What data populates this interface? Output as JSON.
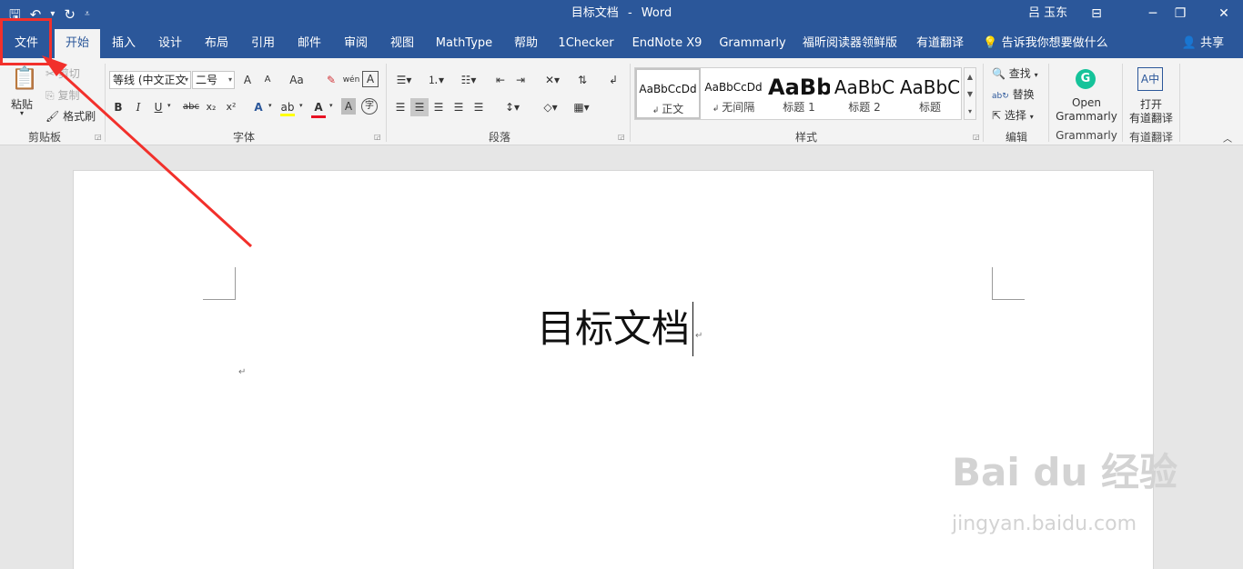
{
  "window": {
    "doc_name": "目标文档",
    "app_name": "Word",
    "title_sep": "-",
    "user": "吕 玉东"
  },
  "tabs": [
    "文件",
    "开始",
    "插入",
    "设计",
    "布局",
    "引用",
    "邮件",
    "审阅",
    "视图",
    "MathType",
    "帮助",
    "1Checker",
    "EndNote X9",
    "Grammarly",
    "福昕阅读器领鲜版",
    "有道翻译"
  ],
  "tell_me": "告诉我你想要做什么",
  "share": "共享",
  "clipboard": {
    "paste": "粘贴",
    "cut": "剪切",
    "copy": "复制",
    "format_painter": "格式刷",
    "label": "剪贴板"
  },
  "font": {
    "name": "等线 (中文正文",
    "size": "二号",
    "grow": "A",
    "shrink": "A",
    "case": "Aa",
    "pinyin": "wén",
    "bold": "B",
    "italic": "I",
    "underline": "U",
    "strike": "abc",
    "subscript": "x₂",
    "superscript": "x²",
    "font_color": "A",
    "label": "字体",
    "font_color_value": "#e81123",
    "highlight_value": "#ffff00"
  },
  "paragraph": {
    "label": "段落"
  },
  "styles": {
    "label": "样式",
    "items": [
      {
        "sample": "AaBbCcDd",
        "name": "正文"
      },
      {
        "sample": "AaBbCcDd",
        "name": "无间隔"
      },
      {
        "sample": "AaBb",
        "name": "标题 1"
      },
      {
        "sample": "AaBbC",
        "name": "标题 2"
      },
      {
        "sample": "AaBbC",
        "name": "标题"
      }
    ]
  },
  "editing": {
    "find": "查找",
    "replace": "替换",
    "select": "选择",
    "label": "编辑"
  },
  "grammarly": {
    "open": "Open",
    "name": "Grammarly",
    "label": "Grammarly"
  },
  "youdao": {
    "open": "打开",
    "name": "有道翻译",
    "label": "有道翻译"
  },
  "document": {
    "heading": "目标文档",
    "para_mark": "↵"
  },
  "watermark": {
    "text": "Bai du 经验",
    "sub": "jingyan.baidu.com"
  },
  "colors": {
    "accent": "#2b579a",
    "annotation": "#f2302b"
  }
}
